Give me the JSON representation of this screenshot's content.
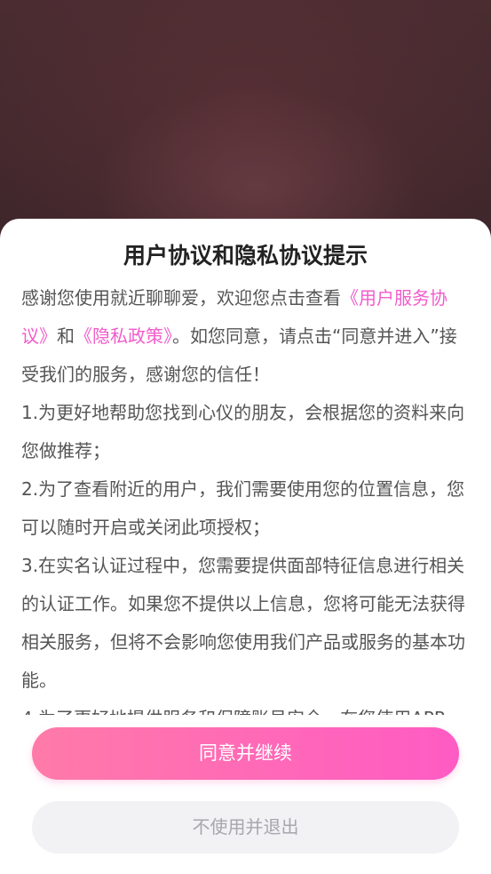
{
  "dialog": {
    "title": "用户协议和隐私协议提示",
    "intro": {
      "p1": "感谢您使用就近聊聊爱，欢迎您点击查看",
      "link_terms": "《用户服务协议》",
      "p2": "和",
      "link_privacy": "《隐私政策》",
      "p3": "。如您同意，请点击“同意并进入”接受我们的服务，感谢您的信任！"
    },
    "items": [
      "1.为更好地帮助您找到心仪的朋友，会根据您的资料来向您做推荐；",
      "2.为了查看附近的用户，我们需要使用您的位置信息，您可以随时开启或关闭此项授权；",
      "3.在实名认证过程中，您需要提供面部特征信息进行相关的认证工作。如果您不提供以上信息，您将可能无法获得相关服务，但将不会影响您使用我们产品或服务的基本功能。",
      "4.为了更好地提供服务和保障账号安全，在您使用APP"
    ],
    "agree_label": "同意并继续",
    "decline_label": "不使用并退出"
  },
  "colors": {
    "link": "#f25ccb",
    "agree_start": "#ff7aa8",
    "agree_end": "#ff5bc4",
    "decline_bg": "#f2f2f5"
  }
}
